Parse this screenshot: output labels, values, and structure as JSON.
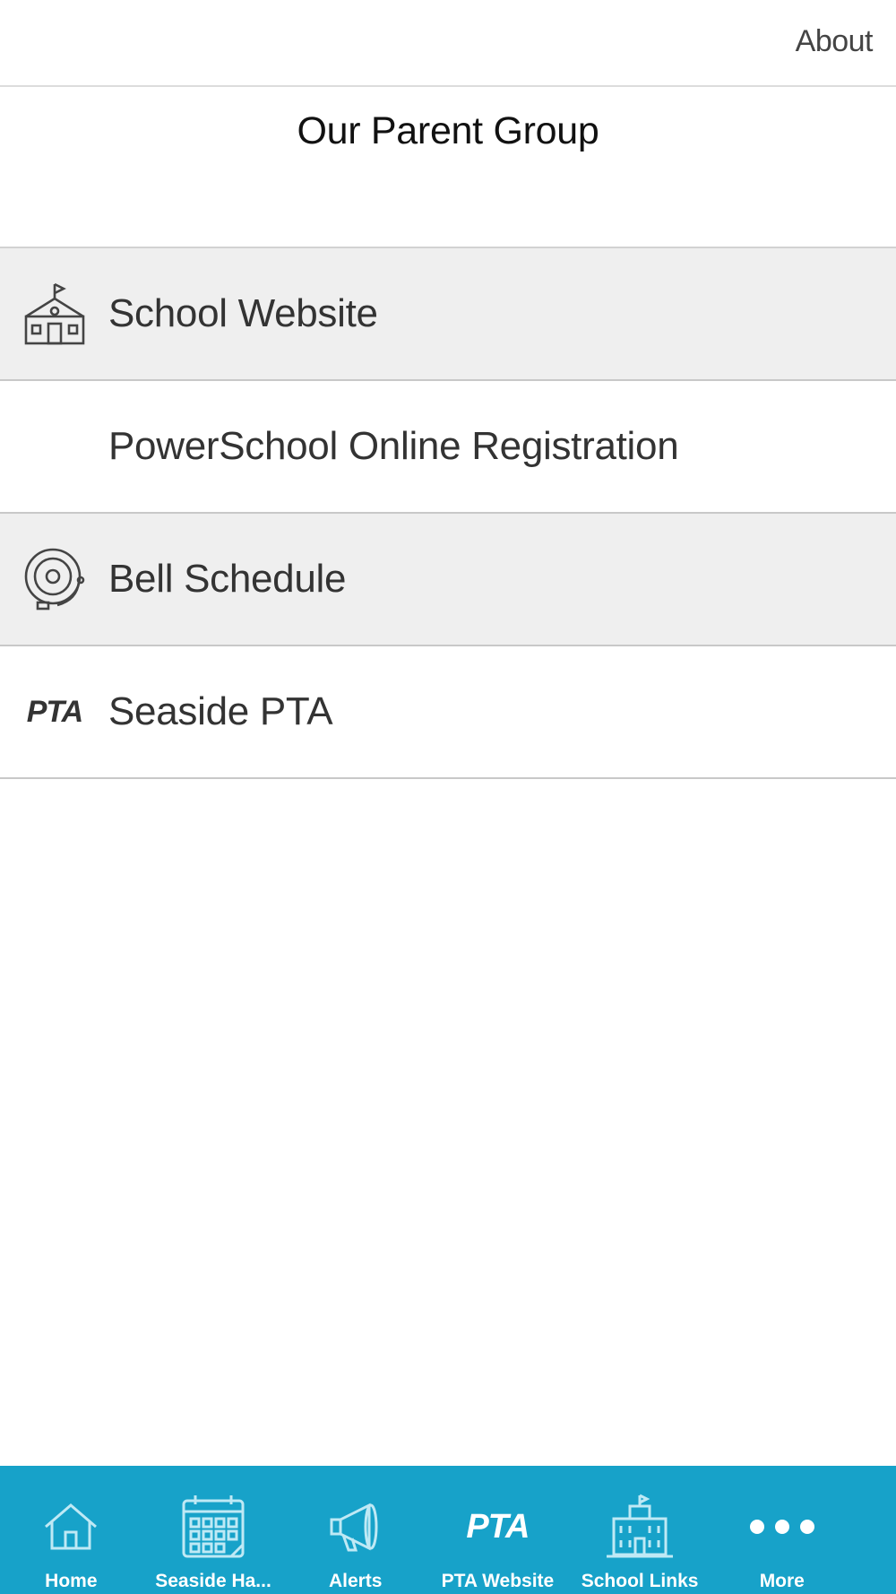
{
  "header": {
    "about_label": "About"
  },
  "page": {
    "title": "Our Parent Group"
  },
  "list": {
    "items": [
      {
        "label": "School Website",
        "icon": "school-house-icon"
      },
      {
        "label": "PowerSchool Online Registration",
        "icon": ""
      },
      {
        "label": "Bell Schedule",
        "icon": "bell-icon"
      },
      {
        "label": "Seaside PTA",
        "icon": "pta-logo-icon",
        "icon_text": "PTA"
      }
    ]
  },
  "tabbar": {
    "color": "#17a2c9",
    "tabs": [
      {
        "label": "Home",
        "icon": "home-icon"
      },
      {
        "label": "Seaside Ha...",
        "icon": "calendar-icon"
      },
      {
        "label": "Alerts",
        "icon": "megaphone-icon"
      },
      {
        "label": "PTA Website",
        "icon": "pta-logo-icon",
        "icon_text": "PTA"
      },
      {
        "label": "School Links",
        "icon": "school-building-icon"
      },
      {
        "label": "More",
        "icon": "more-dots-icon"
      }
    ]
  }
}
